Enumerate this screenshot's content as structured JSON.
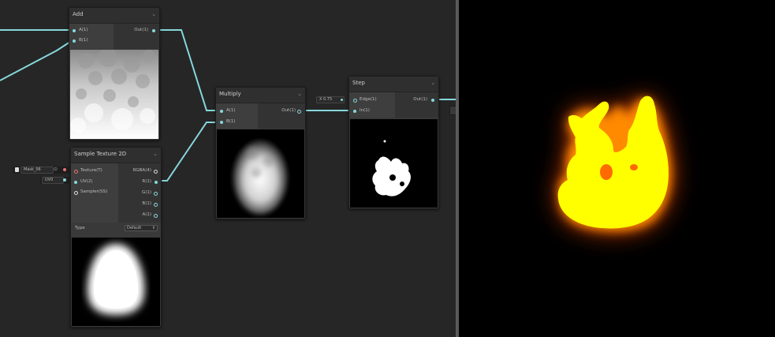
{
  "nodes": {
    "add": {
      "title": "Add",
      "inputs": [
        "A(1)",
        "B(1)"
      ],
      "outputs": [
        "Out(1)"
      ]
    },
    "multiply": {
      "title": "Multiply",
      "inputs": [
        "A(1)",
        "B(1)"
      ],
      "outputs": [
        "Out(1)"
      ]
    },
    "step": {
      "title": "Step",
      "inputs": [
        "Edge(1)",
        "In(1)"
      ],
      "outputs": [
        "Out(1)"
      ],
      "edge_field": {
        "axis": "X",
        "value": "0.75"
      }
    },
    "sample_texture": {
      "title": "Sample Texture 2D",
      "inputs": [
        "Texture(T)",
        "UV(2)",
        "Sampler(SS)"
      ],
      "outputs": [
        "RGBA(4)",
        "R(1)",
        "G(1)",
        "B(1)",
        "A(1)"
      ],
      "type_label": "Type",
      "type_value": "Default",
      "texture_field": "Mask_06",
      "uv_field": "UV0"
    }
  },
  "colors": {
    "wire": "#86d7dc",
    "port_connected": "#86d7dc",
    "port_texture": "#e87070",
    "fire_core": "#ffff00",
    "fire_glow": "#ff5a00"
  }
}
